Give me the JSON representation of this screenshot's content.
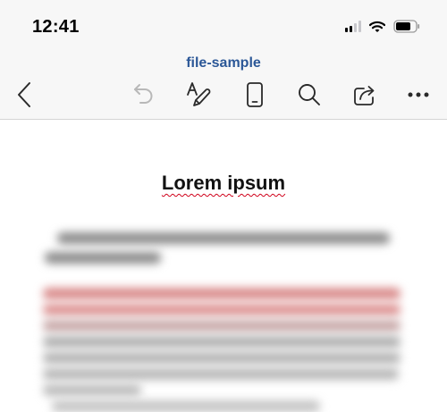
{
  "status_bar": {
    "time": "12:41",
    "signal_icon": "cellular-signal-icon",
    "wifi_icon": "wifi-icon",
    "battery_icon": "battery-icon"
  },
  "document_title": "file-sample",
  "toolbar": {
    "icons": [
      "back-chevron-icon",
      "undo-icon",
      "draw-pen-icon",
      "mobile-view-icon",
      "search-icon",
      "share-icon",
      "more-icon"
    ]
  },
  "document": {
    "heading": "Lorem ipsum"
  },
  "colors": {
    "title_blue": "#2b5797",
    "toolbar_gray": "#f7f7f7",
    "spell_error_red": "#d0021b"
  }
}
